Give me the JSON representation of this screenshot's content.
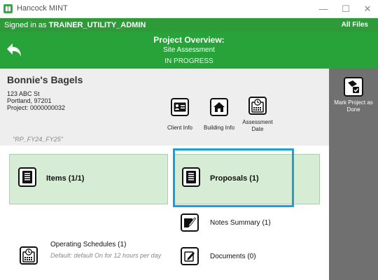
{
  "window": {
    "title": "Hancock MINT",
    "minimize": "—",
    "maximize": "☐",
    "close": "✕"
  },
  "session": {
    "prefix": "Signed in as ",
    "user": "TRAINER_UTILITY_ADMIN",
    "all_files": "All Files"
  },
  "header": {
    "title": "Project Overview:",
    "subtitle": "Site Assessment",
    "status": "IN PROGRESS"
  },
  "project": {
    "company": "Bonnie's Bagels",
    "street": "123 ABC St",
    "city": "Portland, 97201",
    "project_number": "Project: 0000000032",
    "fiscal_tag": "\"RP_FY24_FY25\""
  },
  "info_buttons": {
    "client_info": "Client Info",
    "building_info": "Building Info",
    "assessment_date": "Assessment\nDate"
  },
  "sidebar": {
    "mark_done": "Mark Project as\nDone"
  },
  "tiles": {
    "items": "Items (1/1)",
    "proposals": "Proposals (1)"
  },
  "rows": {
    "notes_summary": "Notes Summary (1)",
    "documents": "Documents (0)"
  },
  "operating_schedules": {
    "title": "Operating Schedules (1)",
    "description": "Default: default On for 12 hours per day"
  },
  "colors": {
    "brand_green": "#27a33a",
    "signed_green": "#2e9a3a",
    "tile_green": "#d6ecd4",
    "selection_blue": "#1a9fd9",
    "sidebar_gray": "#707070"
  }
}
